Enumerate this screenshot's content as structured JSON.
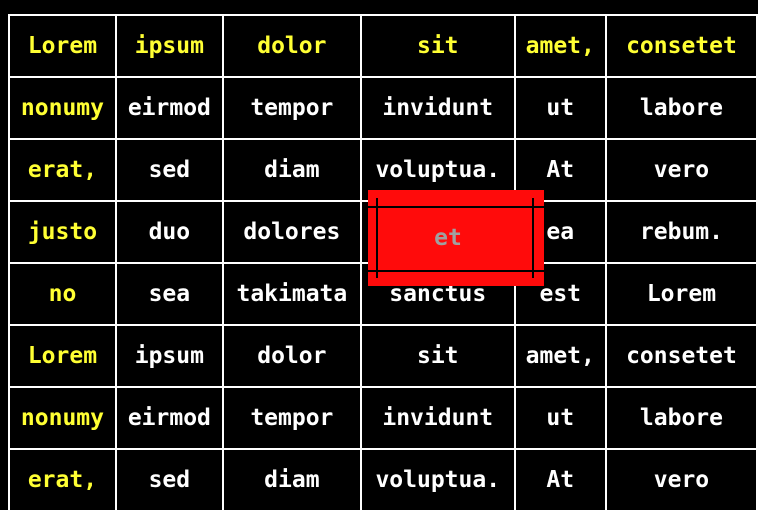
{
  "table": {
    "rows": [
      [
        "Lorem",
        "ipsum",
        "dolor",
        "sit",
        "amet,",
        "consetet"
      ],
      [
        "nonumy",
        "eirmod",
        "tempor",
        "invidunt",
        "ut",
        "labore"
      ],
      [
        "erat,",
        "sed",
        "diam",
        "voluptua.",
        "At",
        "vero"
      ],
      [
        "justo",
        "duo",
        "dolores",
        "",
        "ea",
        "rebum."
      ],
      [
        "no",
        "sea",
        "takimata",
        "sanctus",
        "est",
        "Lorem"
      ],
      [
        "Lorem",
        "ipsum",
        "dolor",
        "sit",
        "amet,",
        "consetet"
      ],
      [
        "nonumy",
        "eirmod",
        "tempor",
        "invidunt",
        "ut",
        "labore"
      ],
      [
        "erat,",
        "sed",
        "diam",
        "voluptua.",
        "At",
        "vero"
      ]
    ]
  },
  "highlight": {
    "text": "et",
    "color": "#ff0b0b"
  },
  "colors": {
    "background": "#000000",
    "header_text": "#ffff33",
    "body_text": "#ffffff",
    "grid_lines": "#ffffff",
    "highlight_text": "#a0a0a0"
  }
}
